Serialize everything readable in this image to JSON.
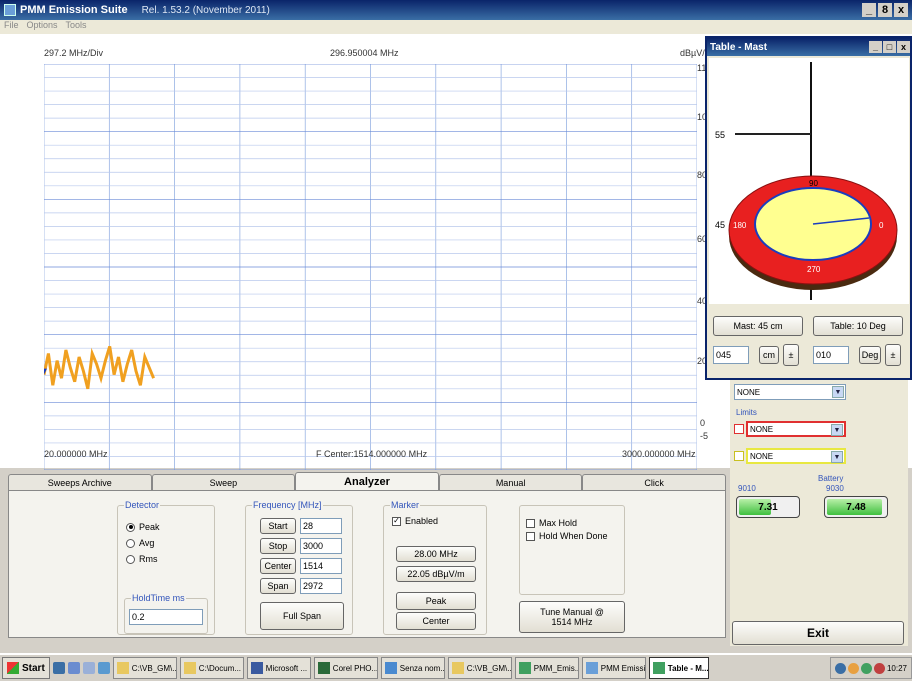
{
  "window": {
    "title": "PMM Emission Suite",
    "version": "Rel. 1.53.2 (November 2011)",
    "controls": [
      "_",
      "8",
      "x"
    ]
  },
  "menu": [
    "File",
    "Options",
    "Tools"
  ],
  "chart": {
    "div_label": "297.2 MHz/Div",
    "center_freq": "296.950004 MHz",
    "unit": "dBµV/m",
    "start_label": "20.000000 MHz",
    "center_label": "F Center:1514.000000 MHz",
    "stop_label": "3000.000000 MHz",
    "y_ticks": [
      "11",
      "10",
      "80",
      "60",
      "40",
      "20",
      "0",
      "-5"
    ]
  },
  "chart_data": {
    "type": "line",
    "xlabel": "",
    "ylabel": "dBµV/m",
    "xlim": [
      20,
      3000
    ],
    "ylim": [
      -5,
      110
    ],
    "grid": true,
    "series": [
      {
        "x": [
          20,
          40,
          60,
          80,
          100,
          120,
          140,
          160,
          180,
          200,
          220,
          240,
          260,
          280,
          300,
          320,
          340,
          360,
          380,
          400,
          420,
          440,
          460,
          480,
          500,
          520
        ],
        "values": [
          22,
          28,
          19,
          26,
          21,
          29,
          24,
          20,
          27,
          23,
          18,
          28,
          25,
          21,
          26,
          30,
          22,
          27,
          20,
          25,
          29,
          23,
          19,
          27,
          24,
          21
        ],
        "color": "#f0a020"
      }
    ]
  },
  "tabs": [
    "Sweeps Archive",
    "Sweep",
    "Analyzer",
    "Manual",
    "Click"
  ],
  "active_tab": "Analyzer",
  "detector": {
    "title": "Detector",
    "options": [
      "Peak",
      "Avg",
      "Rms"
    ],
    "selected": "Peak",
    "holdtime_label": "HoldTime ms",
    "holdtime_value": "0.2"
  },
  "frequency": {
    "title": "Frequency [MHz]",
    "start_label": "Start",
    "start_value": "28",
    "stop_label": "Stop",
    "stop_value": "3000",
    "center_label": "Center",
    "center_value": "1514",
    "span_label": "Span",
    "span_value": "2972",
    "full_span_label": "Full Span"
  },
  "marker": {
    "title": "Marker",
    "enabled_label": "Enabled",
    "enabled": true,
    "freq": "28.00 MHz",
    "level": "22.05 dBµV/m",
    "peak_label": "Peak",
    "center_label": "Center"
  },
  "hold": {
    "max_hold_label": "Max Hold",
    "hold_when_done_label": "Hold When Done",
    "tune_label_1": "Tune Manual @",
    "tune_label_2": "1514 MHz"
  },
  "right": {
    "dropdown1": "NONE",
    "limits_label": "Limits",
    "dropdown2": "NONE",
    "dropdown3": "NONE",
    "battery_label": "Battery",
    "battery1_label": "9010",
    "battery1_value": "7.31",
    "battery1_level": 0.55,
    "battery2_label": "9030",
    "battery2_value": "7.48",
    "battery2_level": 0.95,
    "exit_label": "Exit",
    "red": "#e03030",
    "yellow": "#e8e840"
  },
  "mast": {
    "title": "Table - Mast",
    "mast_height_label": "55",
    "mast_height_label2": "45",
    "table_labels": [
      "90",
      "180",
      "0",
      "270"
    ],
    "mast_status": "Mast: 45 cm",
    "table_status": "Table: 10 Deg",
    "mast_input": "045",
    "mast_unit": "cm",
    "table_input": "010",
    "table_unit": "Deg"
  },
  "taskbar": {
    "start": "Start",
    "tasks": [
      "C:\\VB_GM\\...",
      "C:\\Docum...",
      "Microsoft ...",
      "Corel PHO...",
      "Senza nom...",
      "C:\\VB_GM\\...",
      "PMM_Emis...",
      "PMM Emissi...",
      "Table - M..."
    ],
    "clock": "10:27"
  }
}
